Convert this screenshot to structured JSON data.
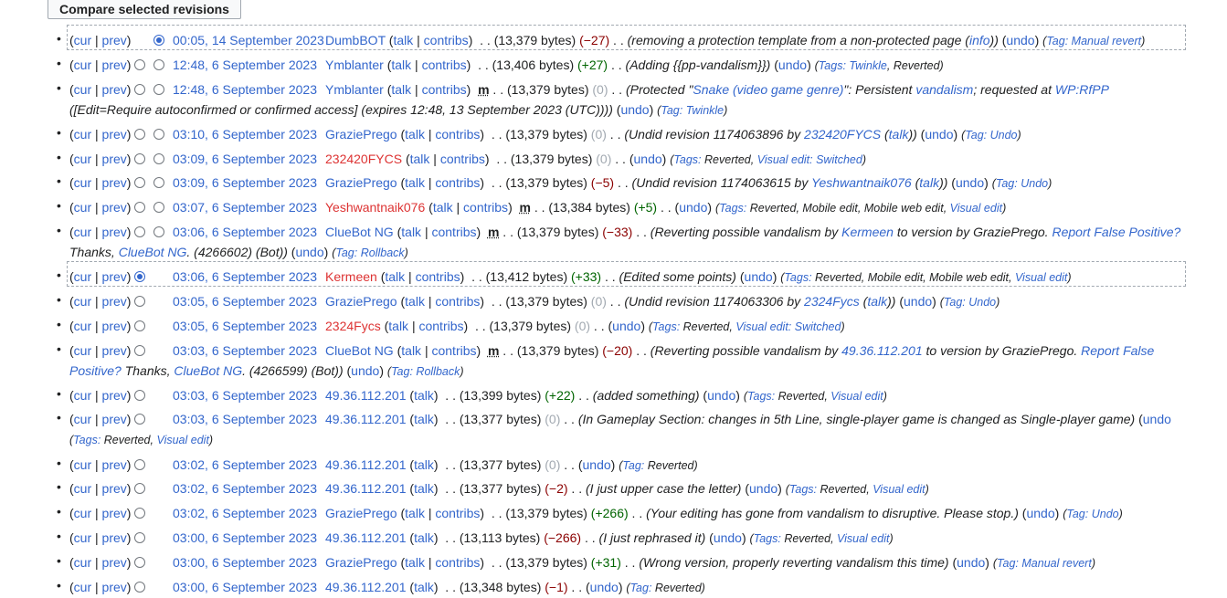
{
  "compare_button": "Compare selected revisions",
  "labels": {
    "cur": "cur",
    "prev": "prev",
    "talk": "talk",
    "contribs": "contribs",
    "undo": "undo",
    "info": "info",
    "tag": "Tag:",
    "tags": "Tags:"
  },
  "rows": [
    {
      "time": "00:05, 14 September 2023",
      "user": "DumbBOT",
      "bytes": "(13,379 bytes)",
      "diff": "(−27)",
      "summary": "removing a protection template from a non-protected page"
    },
    {
      "time": "12:48, 6 September 2023",
      "user": "Ymblanter",
      "bytes": "(13,406 bytes)",
      "diff": "(+27)",
      "summary": "Adding {{pp-vandalism}}",
      "t1": "Twinkle",
      "t2": "Reverted"
    },
    {
      "time": "12:48, 6 September 2023",
      "user": "Ymblanter",
      "minor": "m",
      "bytes": "(13,379 bytes)",
      "diff": "(0)",
      "s_a": "Protected \"",
      "s_link": "Snake (video game genre)",
      "s_b": "\": Persistent ",
      "s_link2": "vandalism",
      "s_c": "; requested at ",
      "s_link3": "WP:RfPP",
      "line2": "([Edit=Require autoconfirmed or confirmed access] (expires 12:48, 13 September 2023 (UTC))))",
      "tag": "Twinkle"
    },
    {
      "time": "03:10, 6 September 2023",
      "user": "GraziePrego",
      "bytes": "(13,379 bytes)",
      "diff": "(0)",
      "s_a": "Undid revision 1174063896 by ",
      "s_user": "232420FYCS",
      "tag": "Undo"
    },
    {
      "time": "03:09, 6 September 2023",
      "user": "232420FYCS",
      "bytes": "(13,379 bytes)",
      "diff": "(0)",
      "t1": "Reverted",
      "t2": "Visual edit: Switched"
    },
    {
      "time": "03:09, 6 September 2023",
      "user": "GraziePrego",
      "bytes": "(13,379 bytes)",
      "diff": "(−5)",
      "s_a": "Undid revision 1174063615 by ",
      "s_user": "Yeshwantnaik076",
      "tag": "Undo"
    },
    {
      "time": "03:07, 6 September 2023",
      "user": "Yeshwantnaik076",
      "minor": "m",
      "bytes": "(13,384 bytes)",
      "diff": "(+5)",
      "t1": "Reverted",
      "t2": "Mobile edit",
      "t3": "Mobile web edit",
      "t4": "Visual edit"
    },
    {
      "time": "03:06, 6 September 2023",
      "user": "ClueBot NG",
      "minor": "m",
      "bytes": "(13,379 bytes)",
      "diff": "(−33)",
      "s_a": "Reverting possible vandalism by ",
      "s_user": "Kermeen",
      "s_b": " to version by GraziePrego. ",
      "s_link": "Report False Positive?",
      "l2_a": "Thanks, ",
      "l2_link": "ClueBot NG",
      "l2_b": ". (4266602) (Bot))",
      "tag": "Rollback"
    },
    {
      "time": "03:06, 6 September 2023",
      "user": "Kermeen",
      "bytes": "(13,412 bytes)",
      "diff": "(+33)",
      "summary": "Edited some points",
      "t1": "Reverted",
      "t2": "Mobile edit",
      "t3": "Mobile web edit",
      "t4": "Visual edit"
    },
    {
      "time": "03:05, 6 September 2023",
      "user": "GraziePrego",
      "bytes": "(13,379 bytes)",
      "diff": "(0)",
      "s_a": "Undid revision 1174063306 by ",
      "s_user": "2324Fycs",
      "tag": "Undo"
    },
    {
      "time": "03:05, 6 September 2023",
      "user": "2324Fycs",
      "bytes": "(13,379 bytes)",
      "diff": "(0)",
      "t1": "Reverted",
      "t2": "Visual edit: Switched"
    },
    {
      "time": "03:03, 6 September 2023",
      "user": "ClueBot NG",
      "minor": "m",
      "bytes": "(13,379 bytes)",
      "diff": "(−20)",
      "s_a": "Reverting possible vandalism by ",
      "s_user": "49.36.112.201",
      "s_b": " to version by GraziePrego. ",
      "s_link": "Report False",
      "l2_link0": "Positive?",
      "l2_a": " Thanks, ",
      "l2_link": "ClueBot NG",
      "l2_b": ". (4266599) (Bot))",
      "tag": "Rollback"
    },
    {
      "time": "03:03, 6 September 2023",
      "user": "49.36.112.201",
      "bytes": "(13,399 bytes)",
      "diff": "(+22)",
      "summary": "added something",
      "t1": "Reverted",
      "t2": "Visual edit"
    },
    {
      "time": "03:03, 6 September 2023",
      "user": "49.36.112.201",
      "bytes": "(13,377 bytes)",
      "diff": "(0)",
      "summary": "In Gameplay Section: changes in 5th Line, single-player game is changed as Single-player game",
      "t1": "Reverted",
      "t2": "Visual edit"
    },
    {
      "time": "03:02, 6 September 2023",
      "user": "49.36.112.201",
      "bytes": "(13,377 bytes)",
      "diff": "(0)",
      "tag": "Reverted"
    },
    {
      "time": "03:02, 6 September 2023",
      "user": "49.36.112.201",
      "bytes": "(13,377 bytes)",
      "diff": "(−2)",
      "summary": "I just upper case the letter",
      "t1": "Reverted",
      "t2": "Visual edit"
    },
    {
      "time": "03:02, 6 September 2023",
      "user": "GraziePrego",
      "bytes": "(13,379 bytes)",
      "diff": "(+266)",
      "summary": "Your editing has gone from vandalism to disruptive. Please stop.",
      "tag": "Undo"
    },
    {
      "time": "03:00, 6 September 2023",
      "user": "49.36.112.201",
      "bytes": "(13,113 bytes)",
      "diff": "(−266)",
      "summary": "I just rephrased it",
      "t1": "Reverted",
      "t2": "Visual edit"
    },
    {
      "time": "03:00, 6 September 2023",
      "user": "GraziePrego",
      "bytes": "(13,379 bytes)",
      "diff": "(+31)",
      "summary": "Wrong version, properly reverting vandalism this time",
      "tag": "Manual revert"
    },
    {
      "time": "03:00, 6 September 2023",
      "user": "49.36.112.201",
      "bytes": "(13,348 bytes)",
      "diff": "(−1)",
      "tag": "Reverted"
    }
  ]
}
